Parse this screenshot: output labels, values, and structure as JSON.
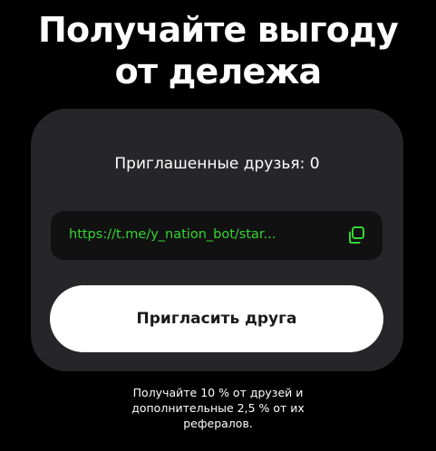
{
  "headline": {
    "line1": "Получайте выгоду",
    "line2": "от дележа"
  },
  "card": {
    "invited_label": "Приглашенные друзья: 0",
    "referral_link": "https://t.me/y_nation_bot/star...",
    "copy_icon": "copy-icon",
    "invite_button_label": "Пригласить друга"
  },
  "footer": {
    "line1": "Получайте 10 % от друзей и",
    "line2": "дополнительные 2,5 % от их",
    "line3": "рефералов."
  },
  "colors": {
    "background": "#000000",
    "card": "#262628",
    "link_box": "#111112",
    "link_text": "#34d631",
    "button": "#ffffff"
  }
}
